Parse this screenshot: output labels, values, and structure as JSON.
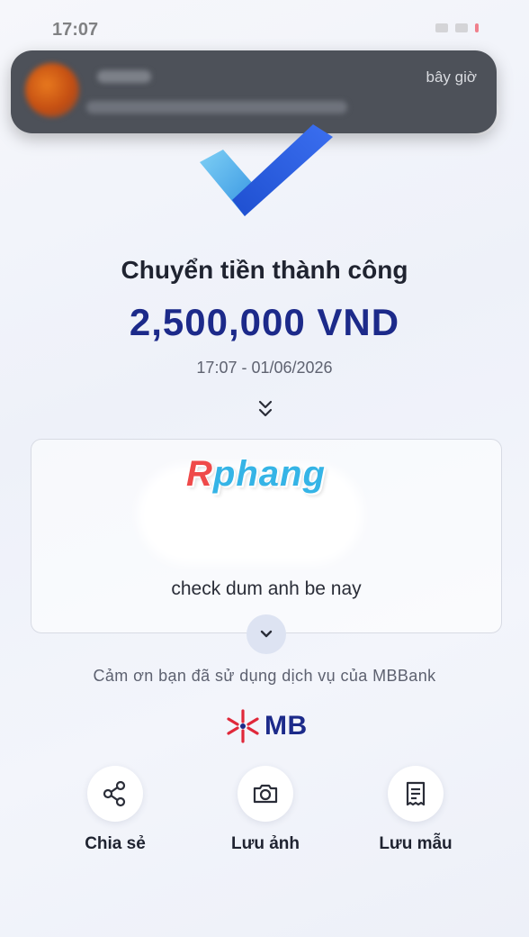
{
  "status_bar": {
    "time": "17:07"
  },
  "notification": {
    "time": "bây giờ"
  },
  "result": {
    "title": "Chuyển tiền thành công",
    "amount": "2,500,000 VND",
    "datetime": "17:07 - 01/06/2026"
  },
  "message_card": {
    "watermark": {
      "first_letter": "R",
      "rest": "phang"
    },
    "message": "check dum anh be nay"
  },
  "footer": {
    "thanks": "Cảm ơn bạn đã sử dụng dịch vụ của MBBank",
    "brand": "MB"
  },
  "actions": [
    {
      "label": "Chia sẻ",
      "icon": "share-icon"
    },
    {
      "label": "Lưu ảnh",
      "icon": "camera-icon"
    },
    {
      "label": "Lưu mẫu",
      "icon": "receipt-icon"
    }
  ],
  "colors": {
    "brand_blue": "#1c2a8a",
    "brand_red": "#e0283a",
    "check_light": "#5ab4ec",
    "check_dark": "#2a57d6"
  }
}
